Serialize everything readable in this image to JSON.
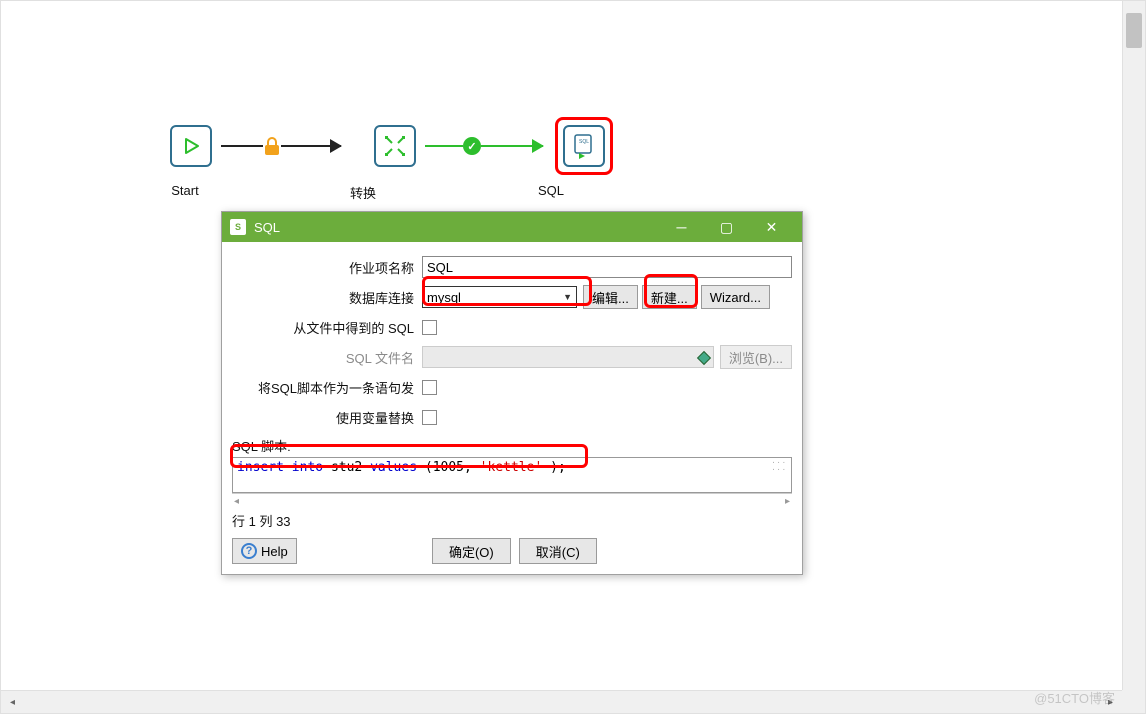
{
  "flow": {
    "start_label": "Start",
    "transform_label": "转换",
    "sql_label": "SQL"
  },
  "dialog": {
    "title": "SQL",
    "fields": {
      "job_name_label": "作业项名称",
      "job_name_value": "SQL",
      "db_conn_label": "数据库连接",
      "db_conn_value": "mysql",
      "edit_btn": "编辑...",
      "new_btn": "新建...",
      "wizard_btn": "Wizard...",
      "from_file_label": "从文件中得到的 SQL",
      "sql_filename_label": "SQL 文件名",
      "browse_btn": "浏览(B)...",
      "single_stmt_label": "将SQL脚本作为一条语句发",
      "var_replace_label": "使用变量替换"
    },
    "sql": {
      "label": "SQL 脚本:",
      "code_kw1": "insert",
      "code_kw2": "into",
      "code_id": " stu2 ",
      "code_kw3": "values",
      "code_paren_open": "(1005,",
      "code_str": "'kettle'",
      "code_paren_close": ");",
      "position": "行 1 列 33"
    },
    "buttons": {
      "help": "Help",
      "ok": "确定(O)",
      "cancel": "取消(C)"
    }
  },
  "watermark": "@51CTO博客"
}
